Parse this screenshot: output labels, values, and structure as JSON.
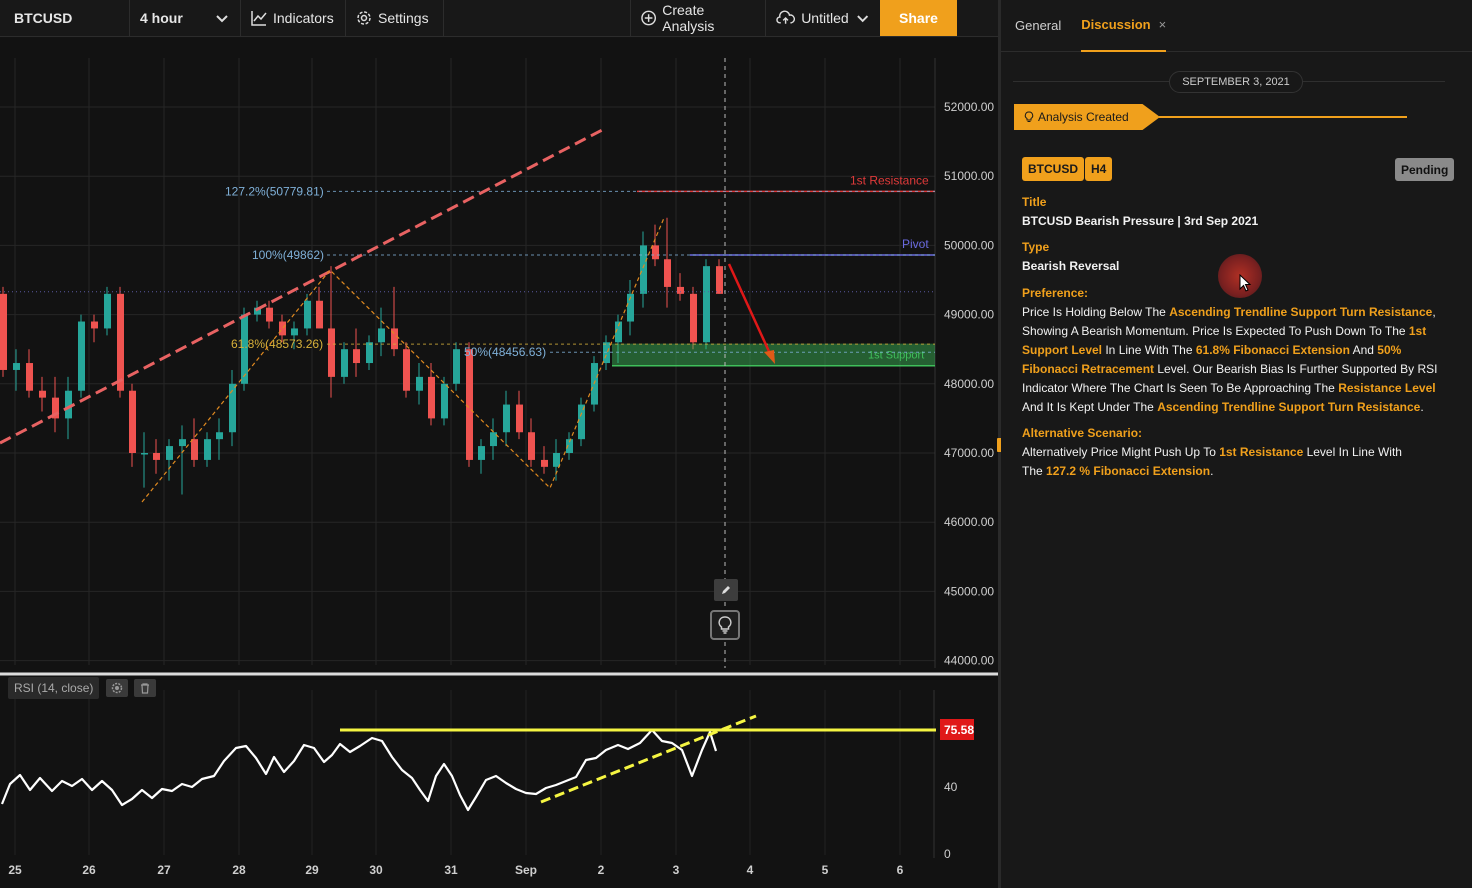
{
  "toolbar": {
    "symbol": "BTCUSD",
    "interval": "4 hour",
    "indicators_label": "Indicators",
    "settings_label": "Settings",
    "create_analysis_label": "Create Analysis",
    "layout_name": "Untitled",
    "share_label": "Share"
  },
  "chart": {
    "price_axis": [
      "52000.00",
      "51000.00",
      "50000.00",
      "49000.00",
      "48000.00",
      "47000.00",
      "46000.00",
      "45000.00",
      "44000.00"
    ],
    "time_axis": [
      "25",
      "26",
      "27",
      "28",
      "29",
      "30",
      "31",
      "Sep",
      "2",
      "3",
      "4",
      "5",
      "6"
    ],
    "fib_levels": [
      {
        "label": "127.2%(50779.81)",
        "color": "#7fb0d8"
      },
      {
        "label": "100%(49862)",
        "color": "#7fb0d8"
      },
      {
        "label": "61.8%(48573.26)",
        "color": "#d8b13a"
      },
      {
        "label": "50%(48456.63)",
        "color": "#7fb0d8"
      }
    ],
    "level_labels": {
      "resistance": "1st Resistance",
      "pivot": "Pivot",
      "support": "1st Support"
    },
    "colors": {
      "up": "#26a69a",
      "down": "#ef5350",
      "resistance": "#e03a3a",
      "pivot": "#6a6ae0",
      "support": "#3fbf5a",
      "trendline": "#e86262",
      "rsi_line": "#ffffff",
      "rsi_markup": "#f5f542"
    }
  },
  "rsi": {
    "label": "RSI (14, close)",
    "current_value": "75.58",
    "axis": [
      "40",
      "0"
    ]
  },
  "panel": {
    "tabs": [
      {
        "label": "General",
        "active": false
      },
      {
        "label": "Discussion",
        "active": true,
        "close": "×"
      }
    ],
    "date": "SEPTEMBER 3, 2021",
    "event": "Analysis Created",
    "symbol_tag": "BTCUSD",
    "timeframe_tag": "H4",
    "status": "Pending",
    "title_label": "Title",
    "title_value": "BTCUSD Bearish Pressure | 3rd Sep 2021",
    "type_label": "Type",
    "type_value": "Bearish Reversal",
    "preference_label": "Preference:",
    "preference_text": [
      {
        "t": "Price Is Holding Below The ",
        "hl": false
      },
      {
        "t": "Ascending Trendline Support Turn Resistance",
        "hl": true
      },
      {
        "t": ", Showing A Bearish Momentum. Price Is Expected To Push Down To The ",
        "hl": false
      },
      {
        "t": "1st Support Level",
        "hl": true
      },
      {
        "t": " In Line With The ",
        "hl": false
      },
      {
        "t": "61.8% Fibonacci Extension",
        "hl": true
      },
      {
        "t": " And ",
        "hl": false
      },
      {
        "t": "50% Fibonacci Retracement",
        "hl": true
      },
      {
        "t": " Level. Our Bearish Bias Is Further Supported By RSI Indicator Where The Chart Is Seen To Be Approaching The ",
        "hl": false
      },
      {
        "t": "Resistance Level",
        "hl": true
      },
      {
        "t": " And It Is Kept Under The ",
        "hl": false
      },
      {
        "t": "Ascending Trendline Support Turn Resistance",
        "hl": true
      },
      {
        "t": ".",
        "hl": false
      }
    ],
    "alternative_label": "Alternative Scenario:",
    "alternative_text": [
      {
        "t": "Alternatively Price Might Push Up To ",
        "hl": false
      },
      {
        "t": "1st Resistance",
        "hl": true
      },
      {
        "t": " Level In Line With The ",
        "hl": false
      },
      {
        "t": "127.2 % Fibonacci Extension",
        "hl": true
      },
      {
        "t": ".",
        "hl": false
      }
    ]
  }
}
